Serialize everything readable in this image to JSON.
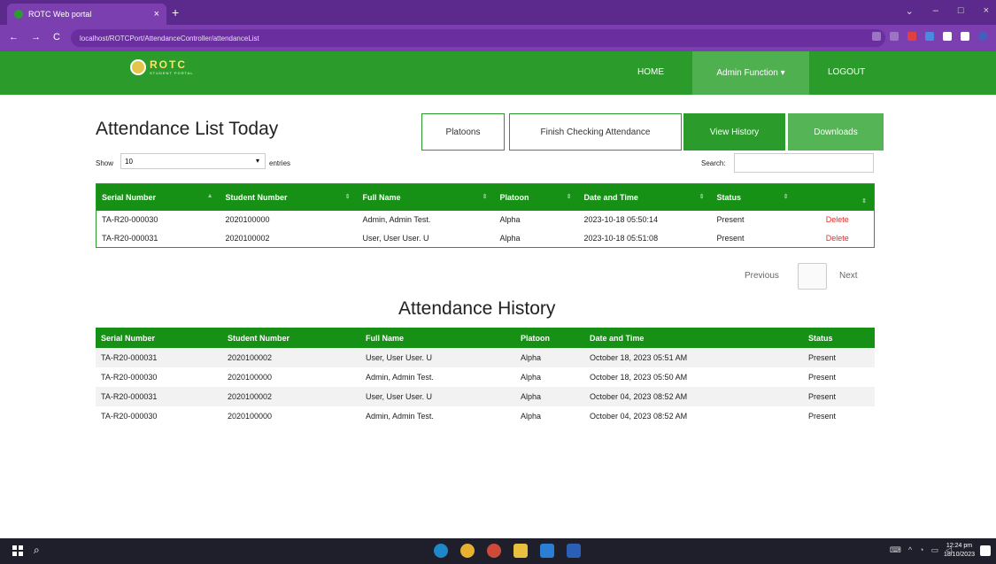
{
  "browser": {
    "tab_title": "ROTC Web portal",
    "tab_close": "×",
    "new_tab": "+",
    "url": "localhost/ROTCPort/AttendanceController/attendanceList",
    "nav": [
      "←",
      "→",
      "C"
    ],
    "window_controls": [
      "⌄",
      "–",
      "□",
      "×"
    ]
  },
  "appbar": {
    "logo_text": "ROTC",
    "logo_sub": "STUDENT PORTAL",
    "home": "HOME",
    "admin": "Admin Function ▾",
    "logout": "LOGOUT"
  },
  "today": {
    "title": "Attendance List Today",
    "buttons": {
      "platoons": "Platoons",
      "finish": "Finish Checking Attendance",
      "view_history": "View History",
      "downloads": "Downloads"
    },
    "show_label": "Show",
    "show_value": "10",
    "entries_label": "entries",
    "search_label": "Search:",
    "columns": [
      "Serial Number",
      "Student Number",
      "Full Name",
      "Platoon",
      "Date and Time",
      "Status",
      ""
    ],
    "rows": [
      [
        "TA-R20-000030",
        "2020100000",
        "Admin, Admin Test.",
        "Alpha",
        "2023-10-18 05:50:14",
        "Present",
        "Delete"
      ],
      [
        "TA-R20-000031",
        "2020100002",
        "User, User User. U",
        "Alpha",
        "2023-10-18 05:51:08",
        "Present",
        "Delete"
      ]
    ],
    "pager": {
      "previous": "Previous",
      "next": "Next"
    }
  },
  "history": {
    "title": "Attendance History",
    "columns": [
      "Serial Number",
      "Student Number",
      "Full Name",
      "Platoon",
      "Date and Time",
      "Status"
    ],
    "rows": [
      [
        "TA-R20-000031",
        "2020100002",
        "User, User User. U",
        "Alpha",
        "October 18, 2023 05:51 AM",
        "Present"
      ],
      [
        "TA-R20-000030",
        "2020100000",
        "Admin, Admin Test.",
        "Alpha",
        "October 18, 2023 05:50 AM",
        "Present"
      ],
      [
        "TA-R20-000031",
        "2020100002",
        "User, User User. U",
        "Alpha",
        "October 04, 2023 08:52 AM",
        "Present"
      ],
      [
        "TA-R20-000030",
        "2020100000",
        "Admin, Admin Test.",
        "Alpha",
        "October 04, 2023 08:52 AM",
        "Present"
      ]
    ]
  },
  "taskbar": {
    "time": "12:24 pm",
    "date": "18/10/2023"
  },
  "colors": {
    "brand_green": "#2b9b2b",
    "header_green": "#169116",
    "browser_purple": "#7b3fb0",
    "delete_red": "#e03030"
  }
}
